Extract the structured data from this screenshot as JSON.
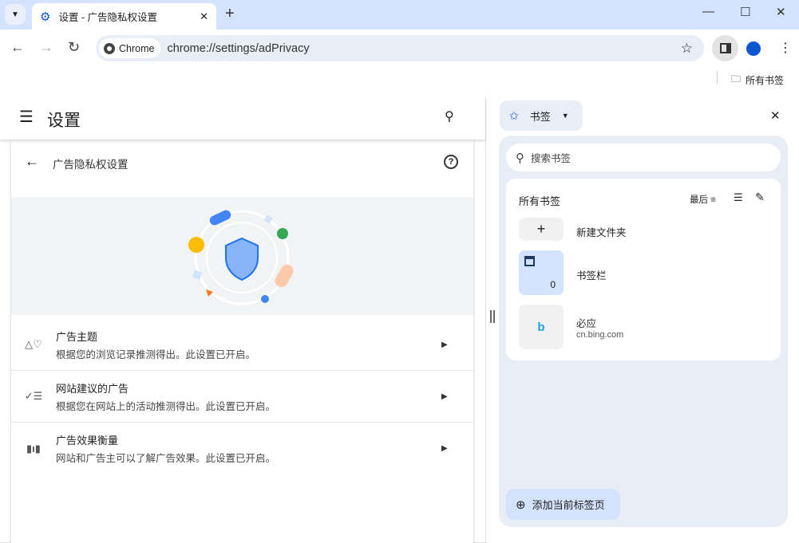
{
  "tab": {
    "title": "设置 - 广告隐私权设置"
  },
  "toolbar": {
    "chip": "Chrome",
    "url": "chrome://settings/adPrivacy"
  },
  "bookmarks_bar": {
    "all_bookmarks": "所有书签"
  },
  "settings": {
    "title": "设置",
    "subpage_title": "广告隐私权设置",
    "rows": [
      {
        "title": "广告主题",
        "desc": "根据您的浏览记录推测得出。此设置已开启。"
      },
      {
        "title": "网站建议的广告",
        "desc": "根据您在网站上的活动推测得出。此设置已开启。"
      },
      {
        "title": "广告效果衡量",
        "desc": "网站和广告主可以了解广告效果。此设置已开启。"
      }
    ]
  },
  "side_panel": {
    "title": "书签",
    "search_placeholder": "搜索书签",
    "list_title": "所有书签",
    "sort_label": "最后",
    "items": [
      {
        "title": "新建文件夹"
      },
      {
        "title": "书签栏",
        "count": "0"
      },
      {
        "title": "必应",
        "url": "cn.bing.com"
      }
    ],
    "add_button": "添加当前标签页"
  },
  "colors": {
    "accent": "#0b57d0",
    "tabstrip": "#d3e3fd",
    "panel": "#e9eef6"
  }
}
